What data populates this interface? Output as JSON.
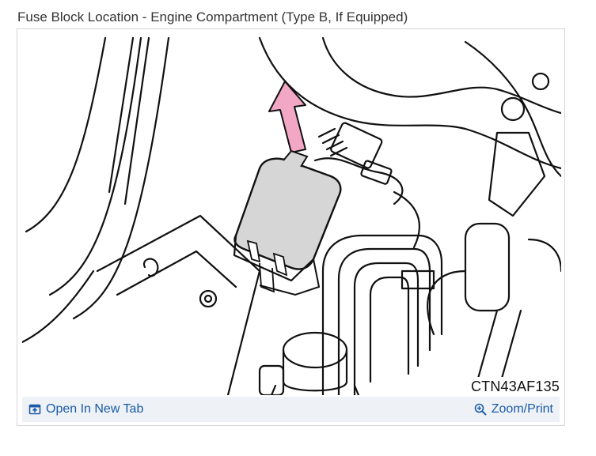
{
  "page": {
    "title": "Fuse Block Location - Engine Compartment (Type B, If Equipped)"
  },
  "figure": {
    "code": "CTN43AF135",
    "arrow_color": "#f2a7c4",
    "fuse_block_color": "#d6d6d6"
  },
  "toolbar": {
    "open_tab_label": "Open In New Tab",
    "open_tab_icon": "open-in-new-tab-icon",
    "zoom_label": "Zoom/Print",
    "zoom_icon": "zoom-in-icon",
    "link_color": "#1a5aa6"
  }
}
